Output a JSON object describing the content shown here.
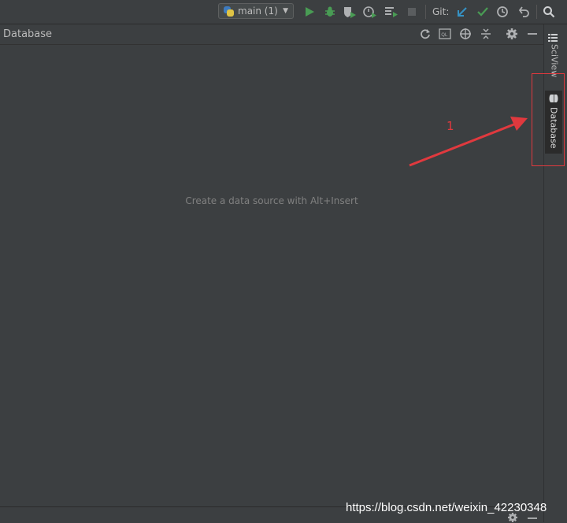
{
  "toolbar": {
    "run_config_label": "main (1)",
    "git_label": "Git:"
  },
  "panel": {
    "title": "Database",
    "empty_message": "Create a data source with Alt+Insert"
  },
  "right_strip": {
    "tabs": [
      {
        "label": "SciView"
      },
      {
        "label": "Database"
      }
    ]
  },
  "annotation": {
    "number": "1",
    "color": "#e0393e"
  },
  "watermark": "https://blog.csdn.net/weixin_42230348",
  "icons": [
    "python-icon",
    "run-icon",
    "debug-icon",
    "coverage-icon",
    "profile-icon",
    "run-concurrency-icon",
    "stop-icon",
    "git-update-icon",
    "git-commit-icon",
    "history-icon",
    "rollback-icon",
    "search-icon",
    "refresh-icon",
    "sql-console-icon",
    "jump-to-source-icon",
    "collapse-all-icon",
    "gear-icon",
    "minimize-icon",
    "database-icon",
    "structure-icon"
  ]
}
